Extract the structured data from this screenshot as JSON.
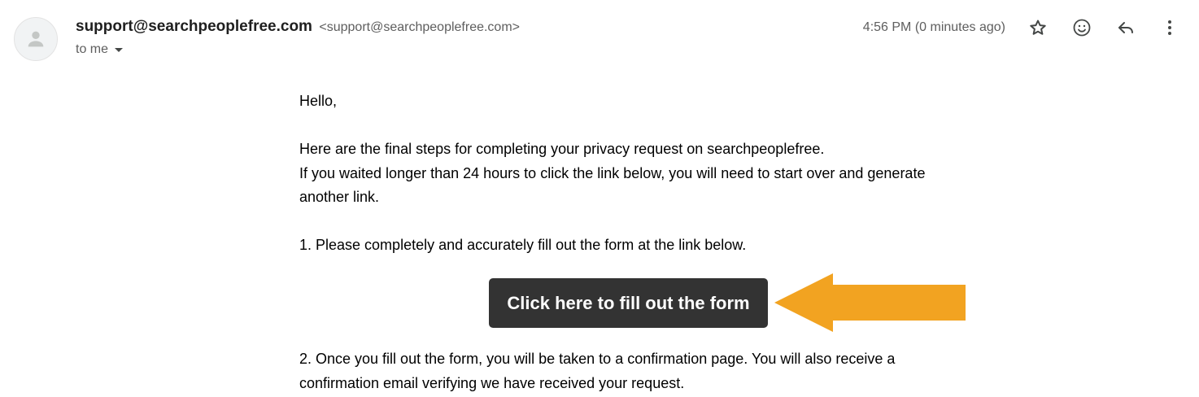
{
  "header": {
    "sender_name": "support@searchpeoplefree.com",
    "sender_email": "<support@searchpeoplefree.com>",
    "recipient": "to me",
    "timestamp": "4:56 PM (0 minutes ago)",
    "icons": [
      "star-icon",
      "emoji-icon",
      "reply-icon",
      "more-vert-icon"
    ]
  },
  "body": {
    "greeting": "Hello,",
    "line1": "Here are the final steps for completing your privacy request on searchpeoplefree.",
    "line2": "If you waited longer than 24 hours to click the link below, you will need to start over and generate another link.",
    "step1": "1. Please completely and accurately fill out the form at the link below.",
    "cta_label": "Click here to fill out the form",
    "step2": "2. Once you fill out the form, you will be taken to a confirmation page. You will also receive a confirmation email verifying we have received your request."
  },
  "colors": {
    "arrow": "#F2A321",
    "button_bg": "#333333",
    "button_text": "#FFFFFF",
    "muted_text": "#5E5E5E"
  }
}
